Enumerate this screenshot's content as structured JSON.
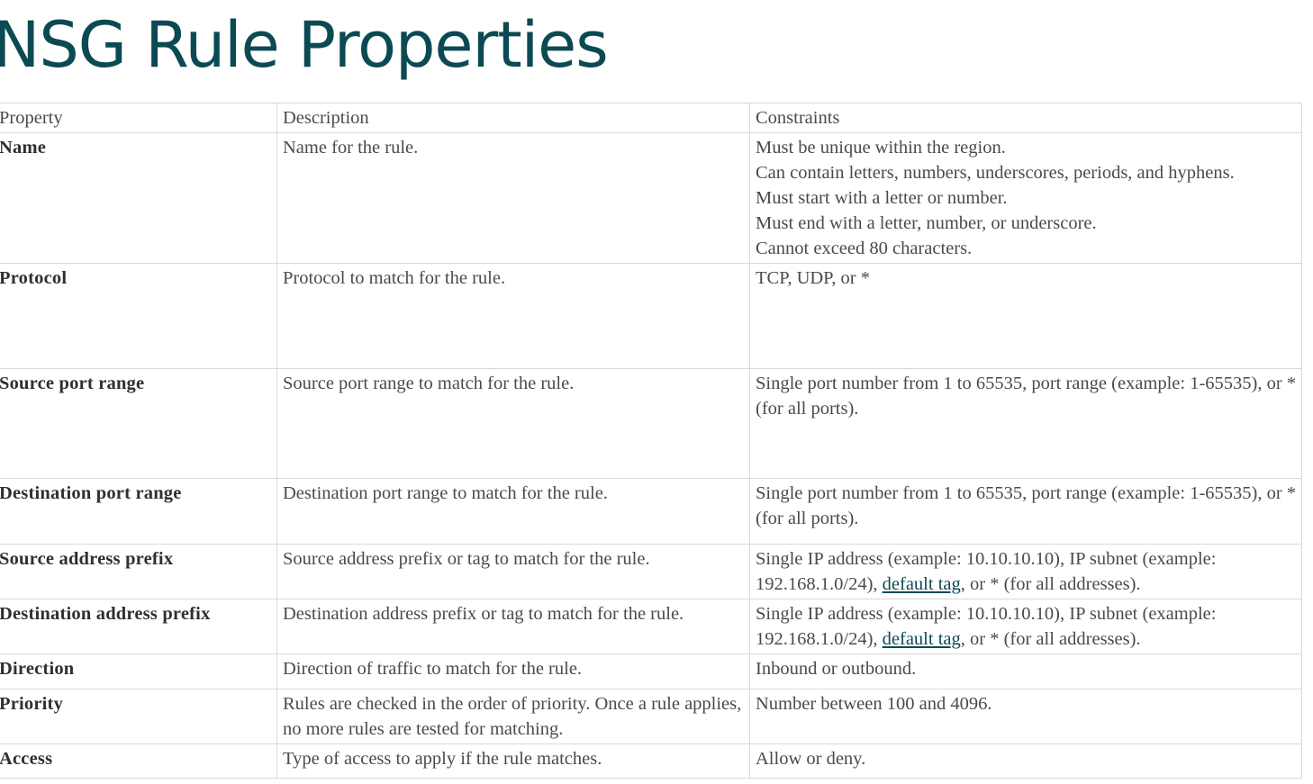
{
  "title": "NSG Rule Properties",
  "colors": {
    "title": "#0b4a53",
    "link": "#0b4a53",
    "grid": "#d9d9d9",
    "text": "#4a4a4a"
  },
  "table": {
    "headers": {
      "property": "Property",
      "description": "Description",
      "constraints": "Constraints"
    },
    "rows": [
      {
        "property": "Name",
        "description": "Name for the rule.",
        "constraints": [
          "Must be unique within the region.",
          "Can contain letters, numbers, underscores, periods, and hyphens.",
          "Must start with a letter or number.",
          "Must end with a letter, number, or underscore.",
          "Cannot exceed 80 characters."
        ]
      },
      {
        "property": "Protocol",
        "description": "Protocol to match for the rule.",
        "constraints": "TCP, UDP, or *"
      },
      {
        "property": "Source port range",
        "description": "Source port range to match for the rule.",
        "constraints": "Single port number from 1 to 65535, port range (example: 1-65535), or * (for all ports)."
      },
      {
        "property": "Destination port range",
        "description": "Destination port range to match for the rule.",
        "constraints": "Single port number from 1 to 65535, port range (example: 1-65535), or * (for all ports)."
      },
      {
        "property": "Source address prefix",
        "description": "Source address prefix or tag to match for the rule.",
        "constraints": {
          "before": "Single IP address (example: 10.10.10.10), IP subnet (example: 192.168.1.0/24), ",
          "link": "default tag",
          "after": ", or * (for all addresses)."
        }
      },
      {
        "property": "Destination address prefix",
        "description": "Destination address prefix or tag to match for the rule.",
        "constraints": {
          "before": "Single IP address (example: 10.10.10.10), IP subnet (example: 192.168.1.0/24), ",
          "link": "default tag",
          "after": ", or * (for all addresses)."
        }
      },
      {
        "property": "Direction",
        "description": "Direction of traffic to match for the rule.",
        "constraints": "Inbound or outbound."
      },
      {
        "property": "Priority",
        "description": "Rules are checked in the order of priority. Once a rule applies, no more rules are tested for matching.",
        "constraints": "Number between 100 and 4096."
      },
      {
        "property": "Access",
        "description": "Type of access to apply if the rule matches.",
        "constraints": "Allow or deny."
      }
    ]
  }
}
